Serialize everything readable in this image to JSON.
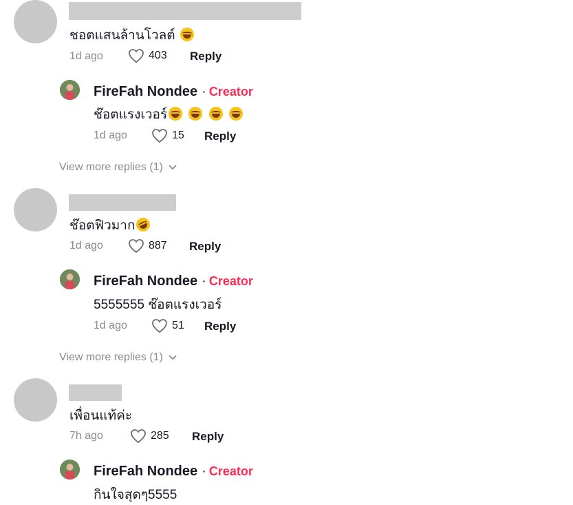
{
  "reply_label": "Reply",
  "creator_label": "Creator",
  "creator_name": "FireFah Nondee",
  "view_more_label": "View more replies (1)",
  "threads": [
    {
      "comment": {
        "text": "ชอตแสนล้านโวลต์",
        "time": "1d ago",
        "likes": "403",
        "emoji": [
          "face-with-tears-of-joy"
        ]
      },
      "reply": {
        "text": "ช๊อตแรงเวอร์",
        "time": "1d ago",
        "likes": "15",
        "emoji": [
          "face-with-tears-of-joy",
          "face-with-tears-of-joy",
          "face-with-tears-of-joy",
          "face-with-tears-of-joy"
        ]
      },
      "show_view_more": true
    },
    {
      "comment": {
        "text": "ช๊อตฟิวมาก",
        "time": "1d ago",
        "likes": "887",
        "emoji": [
          "rolling-on-floor-laughing"
        ]
      },
      "reply": {
        "text": "5555555 ช๊อตแรงเวอร์",
        "time": "1d ago",
        "likes": "51",
        "emoji": []
      },
      "show_view_more": true
    },
    {
      "comment": {
        "text": "เพื่อนแท้ค่ะ",
        "time": "7h ago",
        "likes": "285",
        "emoji": []
      },
      "reply": {
        "text": "กินใจสุดๆ5555",
        "time": "",
        "likes": "",
        "emoji": []
      },
      "show_view_more": false
    }
  ],
  "colors": {
    "creator": "#fe2c55",
    "meta": "#8a8b91",
    "redaction": "#cdcdcd"
  }
}
